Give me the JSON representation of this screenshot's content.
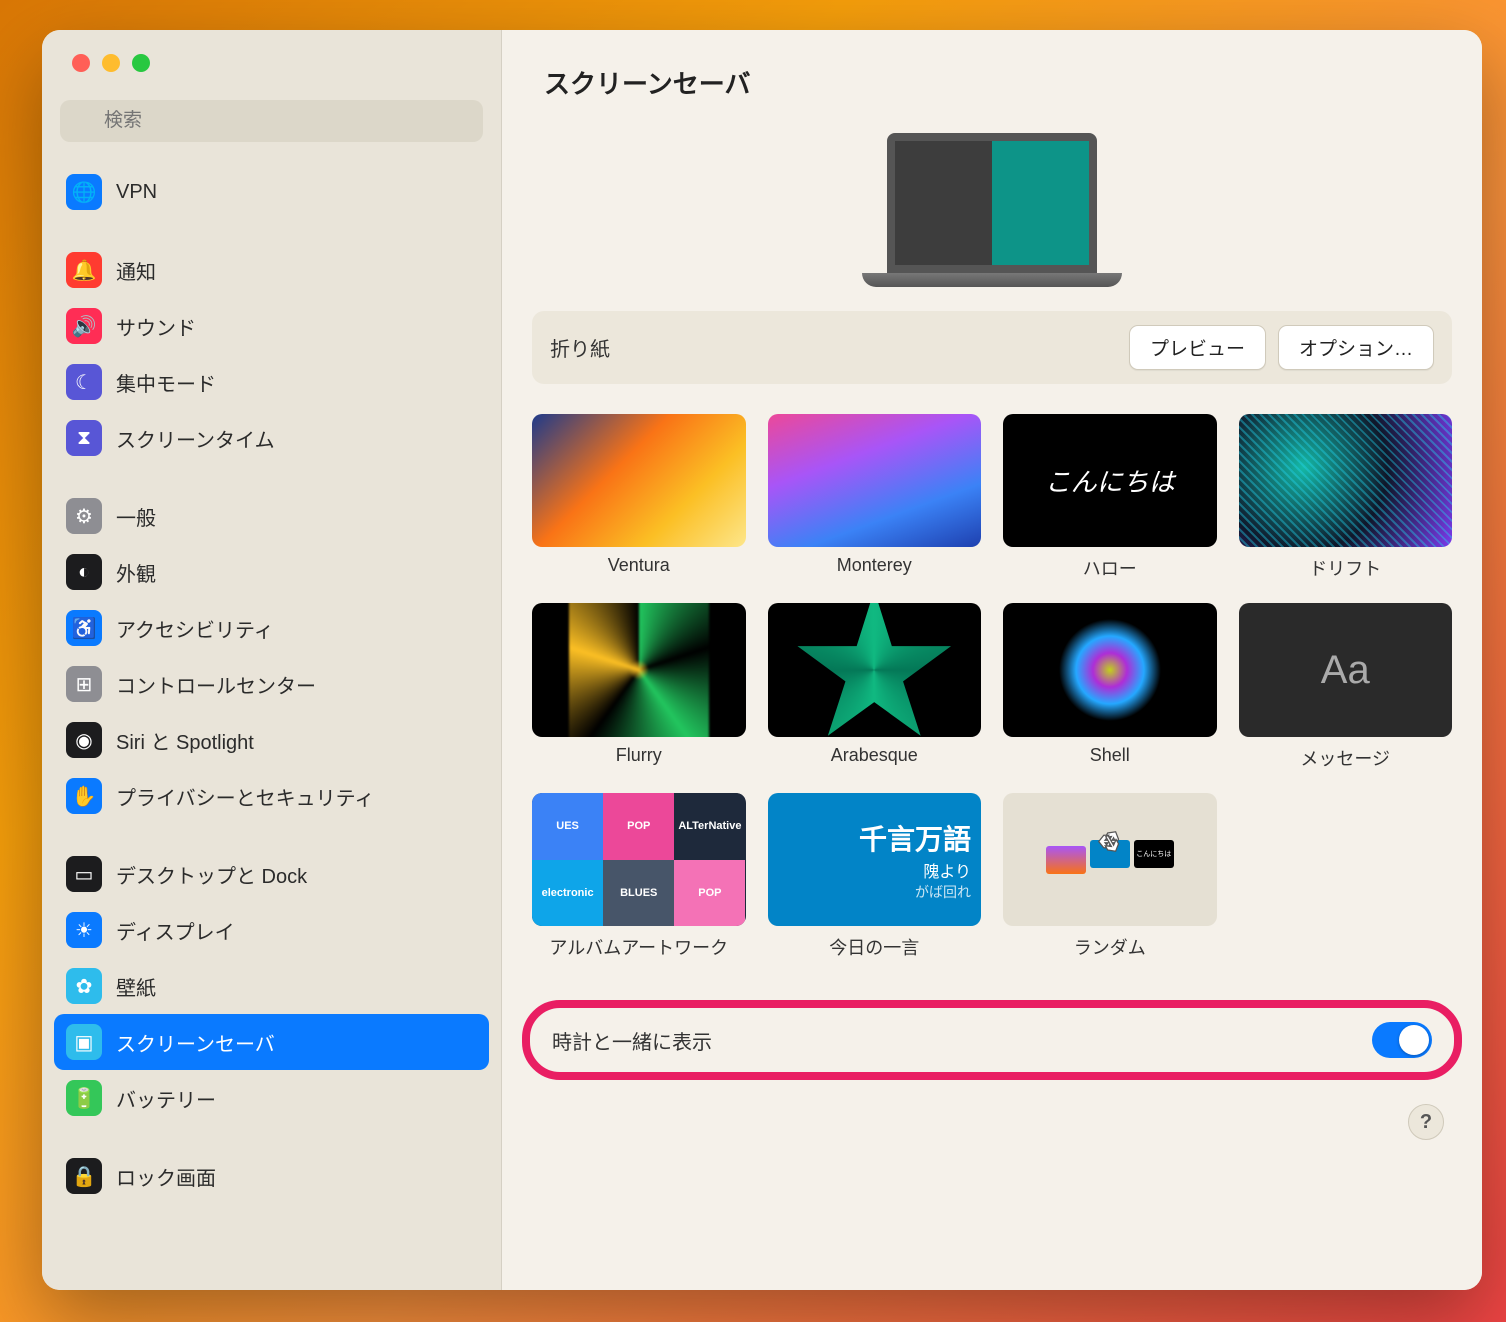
{
  "header": {
    "title": "スクリーンセーバ"
  },
  "search": {
    "placeholder": "検索"
  },
  "sidebar": {
    "items": [
      {
        "label": "VPN",
        "icon_bg": "#0a7aff",
        "icon_name": "globe-icon"
      },
      {
        "label": "通知",
        "icon_bg": "#ff3b30",
        "icon_name": "bell-icon"
      },
      {
        "label": "サウンド",
        "icon_bg": "#ff2d55",
        "icon_name": "speaker-icon"
      },
      {
        "label": "集中モード",
        "icon_bg": "#5856d6",
        "icon_name": "moon-icon"
      },
      {
        "label": "スクリーンタイム",
        "icon_bg": "#5856d6",
        "icon_name": "hourglass-icon"
      },
      {
        "label": "一般",
        "icon_bg": "#8e8e93",
        "icon_name": "gear-icon"
      },
      {
        "label": "外観",
        "icon_bg": "#1c1c1e",
        "icon_name": "appearance-icon"
      },
      {
        "label": "アクセシビリティ",
        "icon_bg": "#0a7aff",
        "icon_name": "accessibility-icon"
      },
      {
        "label": "コントロールセンター",
        "icon_bg": "#8e8e93",
        "icon_name": "switches-icon"
      },
      {
        "label": "Siri と Spotlight",
        "icon_bg": "#1c1c1e",
        "icon_name": "siri-icon"
      },
      {
        "label": "プライバシーとセキュリティ",
        "icon_bg": "#0a7aff",
        "icon_name": "hand-icon"
      },
      {
        "label": "デスクトップと Dock",
        "icon_bg": "#1c1c1e",
        "icon_name": "dock-icon"
      },
      {
        "label": "ディスプレイ",
        "icon_bg": "#0a7aff",
        "icon_name": "brightness-icon"
      },
      {
        "label": "壁紙",
        "icon_bg": "#2ebcec",
        "icon_name": "flower-icon"
      },
      {
        "label": "スクリーンセーバ",
        "icon_bg": "#2ebcec",
        "icon_name": "screensaver-icon",
        "selected": true
      },
      {
        "label": "バッテリー",
        "icon_bg": "#34c759",
        "icon_name": "battery-icon"
      },
      {
        "label": "ロック画面",
        "icon_bg": "#1c1c1e",
        "icon_name": "lock-icon"
      }
    ],
    "gaps_before": [
      1,
      5,
      11,
      16
    ],
    "icon_glyphs": [
      "🌐",
      "🔔",
      "🔊",
      "☾",
      "⧗",
      "⚙",
      "◐",
      "♿",
      "⊞",
      "◉",
      "✋",
      "▭",
      "☀",
      "✿",
      "▣",
      "🔋",
      "🔒"
    ]
  },
  "infobar": {
    "current": "折り紙",
    "preview_btn": "プレビュー",
    "options_btn": "オプション…"
  },
  "screensavers": [
    {
      "label": "Ventura",
      "thumb": "ventura"
    },
    {
      "label": "Monterey",
      "thumb": "monterey"
    },
    {
      "label": "ハロー",
      "thumb": "hello",
      "hello_text": "こんにちは"
    },
    {
      "label": "ドリフト",
      "thumb": "drift"
    },
    {
      "label": "Flurry",
      "thumb": "flurry"
    },
    {
      "label": "Arabesque",
      "thumb": "arabesque"
    },
    {
      "label": "Shell",
      "thumb": "shell"
    },
    {
      "label": "メッセージ",
      "thumb": "message",
      "msg_text": "Aa"
    },
    {
      "label": "アルバムアートワーク",
      "thumb": "album"
    },
    {
      "label": "今日の一言",
      "thumb": "word",
      "word1": "千言万語",
      "word2": "隗より",
      "word3": "がば回れ"
    },
    {
      "label": "ランダム",
      "thumb": "random"
    }
  ],
  "album_tiles": [
    {
      "t": "UES",
      "c": "#3b82f6"
    },
    {
      "t": "POP",
      "c": "#ec4899"
    },
    {
      "t": "ALTerNative",
      "c": "#1e293b"
    },
    {
      "t": "electronic",
      "c": "#0ea5e9"
    },
    {
      "t": "BLUES",
      "c": "#475569"
    },
    {
      "t": "POP",
      "c": "#f472b6"
    }
  ],
  "settings": {
    "show_clock_label": "時計と一緒に表示",
    "show_clock_on": true
  },
  "help": {
    "glyph": "?"
  }
}
